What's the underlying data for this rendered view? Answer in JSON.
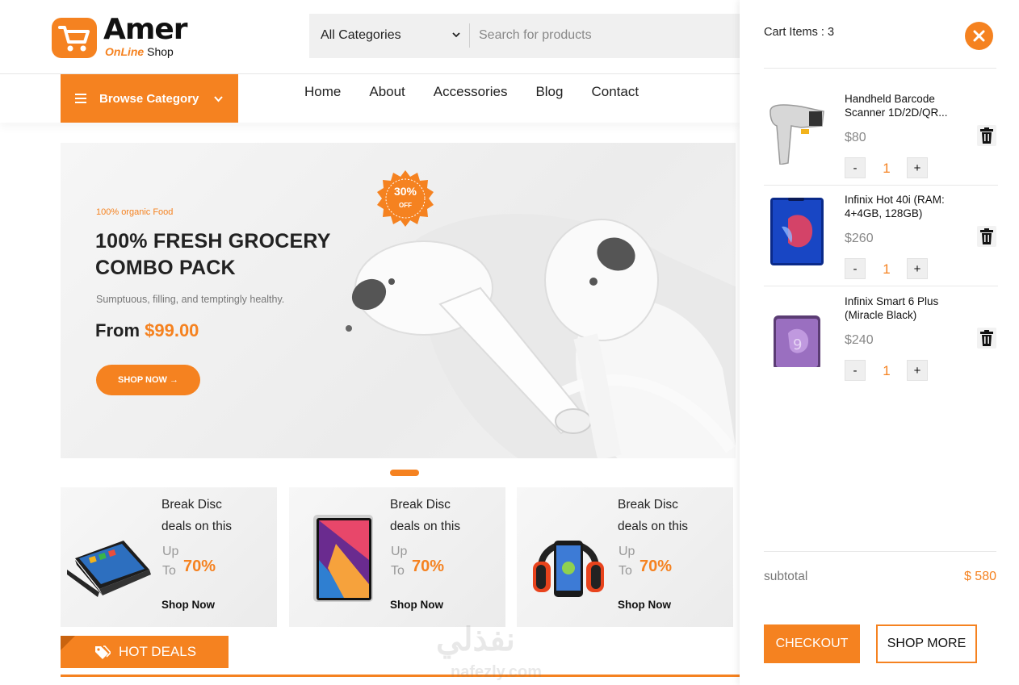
{
  "header": {
    "logo_main": "Amer",
    "logo_sub_accent": "OnLine",
    "logo_sub": "Shop",
    "category_select": "All Categories",
    "search_placeholder": "Search for products",
    "browse_label": "Browse Category"
  },
  "nav": [
    "Home",
    "About",
    "Accessories",
    "Blog",
    "Contact"
  ],
  "hero": {
    "kicker": "100% organic Food",
    "title_line1": "100% FRESH GROCERY",
    "title_line2": "COMBO PACK",
    "description": "Sumptuous, filling, and temptingly healthy.",
    "price_prefix": "From",
    "price": "$99.00",
    "cta": "SHOP NOW →",
    "badge_value": "30%",
    "badge_label": "OFF"
  },
  "promos": [
    {
      "line1": "Break Disc",
      "line2": "deals on this",
      "up": "Up",
      "to": "To",
      "percent": "70%",
      "cta": "Shop Now",
      "icon": "laptop"
    },
    {
      "line1": "Break Disc",
      "line2": "deals on this",
      "up": "Up",
      "to": "To",
      "percent": "70%",
      "cta": "Shop Now",
      "icon": "tablet"
    },
    {
      "line1": "Break Disc",
      "line2": "deals on this",
      "up": "Up",
      "to": "To",
      "percent": "70%",
      "cta": "Shop Now",
      "icon": "phone-headphones"
    }
  ],
  "hot_deals": {
    "label": "HOT DEALS"
  },
  "watermark": {
    "arabic": "نفذلي",
    "latin": "nafezly.com"
  },
  "cart": {
    "title": "Cart Items : 3",
    "items": [
      {
        "name": "Handheld Barcode Scanner 1D/2D/QR...",
        "price": "$80",
        "qty": "1",
        "minus": "-",
        "plus": "+",
        "icon": "barcode-scanner"
      },
      {
        "name": "Infinix Hot 40i (RAM: 4+4GB, 128GB)",
        "price": "$260",
        "qty": "1",
        "minus": "-",
        "plus": "+",
        "icon": "phone-blue"
      },
      {
        "name": "Infinix Smart 6 Plus (Miracle Black)",
        "price": "$240",
        "qty": "1",
        "minus": "-",
        "plus": "+",
        "icon": "phone-purple"
      }
    ],
    "subtotal_label": "subtotal",
    "subtotal_value": "$ 580",
    "checkout": "CHECKOUT",
    "shop_more": "SHOP MORE"
  },
  "colors": {
    "accent": "#f58220",
    "text": "#222222",
    "muted": "#888888"
  }
}
